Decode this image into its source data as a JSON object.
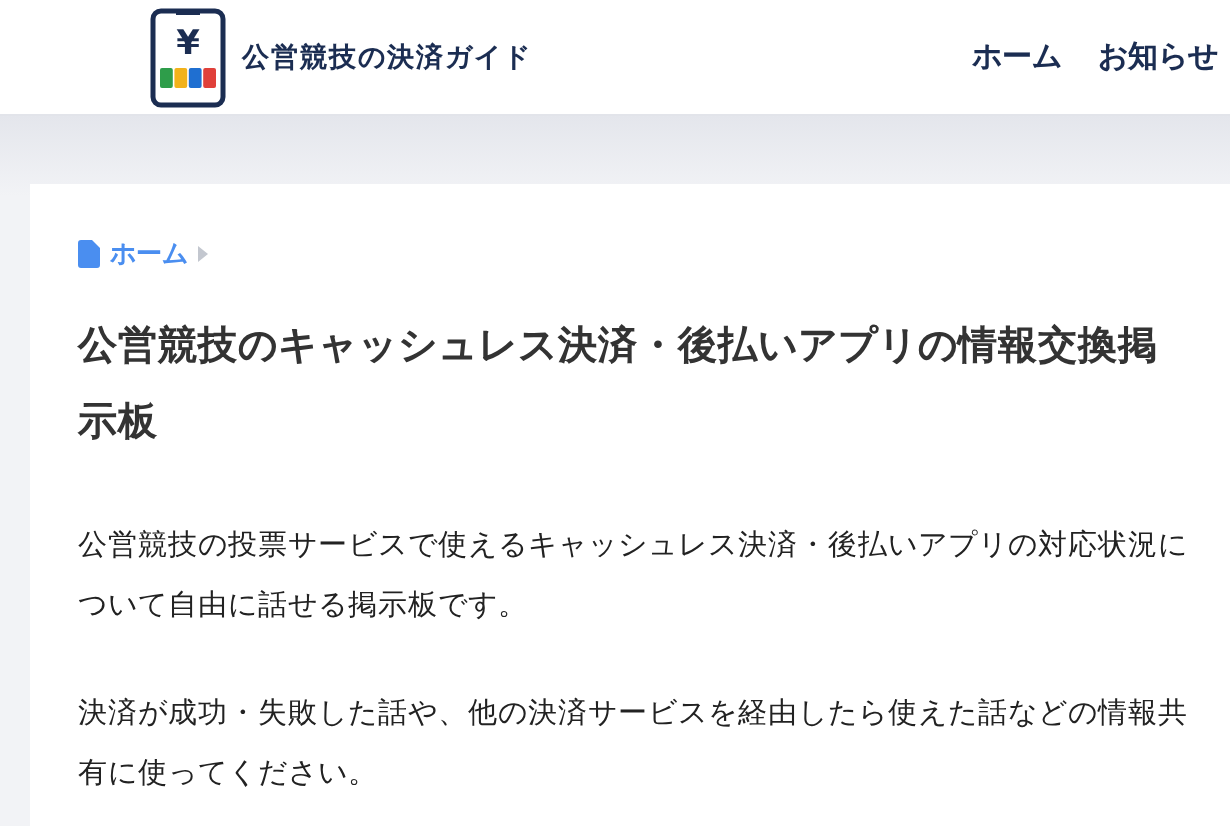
{
  "header": {
    "logo_mark": "¥",
    "site_title": "公営競技の決済ガイド",
    "nav": [
      {
        "label": "ホーム"
      },
      {
        "label": "お知らせ"
      }
    ]
  },
  "breadcrumb": [
    {
      "label": "ホーム"
    }
  ],
  "article": {
    "title": "公営競技のキャッシュレス決済・後払いアプリの情報交換掲示板",
    "paragraphs": [
      "公営競技の投票サービスで使えるキャッシュレス決済・後払いアプリの対応状況について自由に話せる掲示板です。",
      "決済が成功・失敗した話や、他の決済サービスを経由したら使えた話などの情報共有に使ってください。"
    ]
  }
}
